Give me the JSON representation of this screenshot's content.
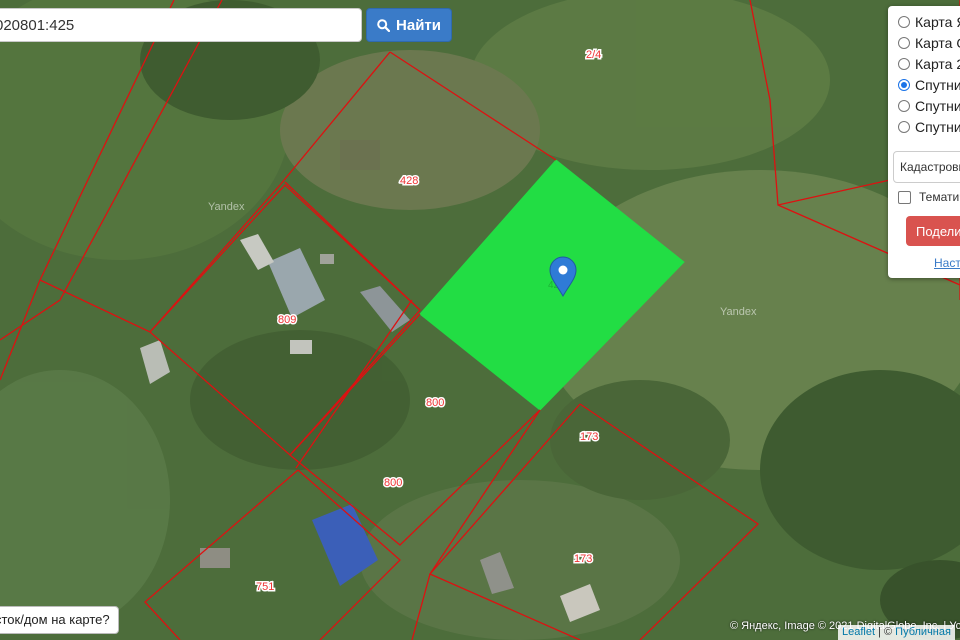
{
  "search": {
    "value": "020801:425",
    "button_label": "Найти"
  },
  "layers": {
    "options": [
      {
        "label": "Карта Я",
        "checked": false
      },
      {
        "label": "Карта О",
        "checked": false
      },
      {
        "label": "Карта 2",
        "checked": false
      },
      {
        "label": "Спутни",
        "checked": true
      },
      {
        "label": "Спутни",
        "checked": false
      },
      {
        "label": "Спутни",
        "checked": false
      }
    ],
    "cadastral_select": "Кадастровы",
    "thematic_label": "Тематич",
    "share_button": "Подели",
    "settings_link": "Наст"
  },
  "map": {
    "parcel_labels": [
      "2/4",
      "428",
      "809",
      "800",
      "800",
      "173",
      "173",
      "751"
    ],
    "selected_parcel_color": "#22dd44",
    "boundary_color": "#dd1111",
    "watermark": "Yandex"
  },
  "find_tip": "сток/дом на карте?",
  "attribution": "© Яндекс, Image © 2021 DigitalGlobe, Inc. | Усл",
  "leaflet": {
    "leaflet_link": "Leaflet",
    "separator": " | © ",
    "public_map_link": "Публичная"
  }
}
